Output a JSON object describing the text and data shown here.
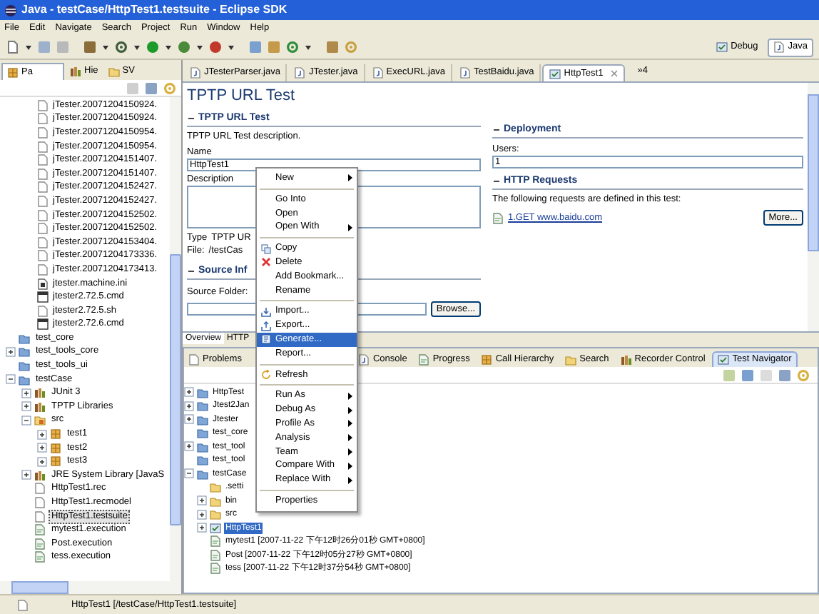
{
  "window": {
    "title": "Java - testCase/HttpTest1.testsuite - Eclipse SDK"
  },
  "menu_bar": [
    "File",
    "Edit",
    "Navigate",
    "Search",
    "Project",
    "Run",
    "Window",
    "Help"
  ],
  "perspectives": [
    {
      "label": "Debug",
      "selected": false
    },
    {
      "label": "Java",
      "selected": true
    }
  ],
  "left_panel": {
    "tabs": [
      {
        "label": "Pa",
        "selected": true
      },
      {
        "label": "Hie",
        "selected": false
      },
      {
        "label": "SV",
        "selected": false
      }
    ],
    "tree_continued": [
      {
        "label": "jTester.20071204150924.",
        "kind": "file",
        "selected": false
      },
      {
        "label": "jTester.20071204150924.",
        "kind": "file",
        "selected": false
      },
      {
        "label": "jTester.20071204150954.",
        "kind": "file",
        "selected": false
      },
      {
        "label": "jTester.20071204150954.",
        "kind": "file",
        "selected": false
      },
      {
        "label": "jTester.20071204151407.",
        "kind": "file",
        "selected": false
      },
      {
        "label": "jTester.20071204151407.",
        "kind": "file",
        "selected": false
      },
      {
        "label": "jTester.20071204152427.",
        "kind": "file",
        "selected": false
      },
      {
        "label": "jTester.20071204152427.",
        "kind": "file",
        "selected": false
      },
      {
        "label": "jTester.20071204152502.",
        "kind": "file",
        "selected": false
      },
      {
        "label": "jTester.20071204152502.",
        "kind": "file",
        "selected": false
      },
      {
        "label": "jTester.20071204153404.",
        "kind": "file",
        "selected": false
      },
      {
        "label": "jTester.20071204173336.",
        "kind": "file",
        "selected": false
      },
      {
        "label": "jTester.20071204173413.",
        "kind": "file",
        "selected": false
      },
      {
        "label": "jtester.machine.ini",
        "kind": "ini",
        "selected": false
      },
      {
        "label": "jtester2.72.5.cmd",
        "kind": "cmd",
        "selected": false
      },
      {
        "label": "jtester2.72.5.sh",
        "kind": "file",
        "selected": false
      },
      {
        "label": "jtester2.72.6.cmd",
        "kind": "cmd",
        "selected": false
      }
    ],
    "tree": [
      {
        "label": "test_core",
        "kind": "project",
        "selected": false
      },
      {
        "label": "test_tools_core",
        "kind": "project",
        "expanded": false,
        "selected": false
      },
      {
        "label": "test_tools_ui",
        "kind": "project",
        "selected": false
      },
      {
        "label": "testCase",
        "kind": "project",
        "expanded": true,
        "selected": false,
        "children": [
          {
            "label": "JUnit 3",
            "kind": "library",
            "expanded": false,
            "selected": false
          },
          {
            "label": "TPTP Libraries",
            "kind": "library",
            "expanded": false,
            "selected": false
          },
          {
            "label": "src",
            "kind": "srcfolder",
            "expanded": true,
            "selected": false,
            "children": [
              {
                "label": "test1",
                "kind": "package",
                "expanded": false,
                "selected": false
              },
              {
                "label": "test2",
                "kind": "package",
                "expanded": false,
                "selected": false
              },
              {
                "label": "test3",
                "kind": "package",
                "expanded": false,
                "selected": false
              }
            ]
          },
          {
            "label": "JRE System Library [JavaS",
            "kind": "library",
            "expanded": false,
            "selected": false
          },
          {
            "label": "HttpTest1.rec",
            "kind": "file",
            "selected": false
          },
          {
            "label": "HttpTest1.recmodel",
            "kind": "file",
            "selected": false
          },
          {
            "label": "HttpTest1.testsuite",
            "kind": "file",
            "selected": true
          },
          {
            "label": "mytest1.execution",
            "kind": "execution",
            "selected": false
          },
          {
            "label": "Post.execution",
            "kind": "execution",
            "selected": false
          },
          {
            "label": "tess.execution",
            "kind": "execution",
            "selected": false
          }
        ]
      }
    ]
  },
  "editor": {
    "tabs": [
      {
        "label": "JTesterParser.java",
        "kind": "java",
        "selected": false
      },
      {
        "label": "JTester.java",
        "kind": "java",
        "selected": false
      },
      {
        "label": "ExecURL.java",
        "kind": "java",
        "selected": false
      },
      {
        "label": "TestBaidu.java",
        "kind": "java",
        "selected": false
      },
      {
        "label": "HttpTest1",
        "kind": "test",
        "selected": true
      }
    ],
    "overflow": "»4",
    "title": "TPTP URL Test",
    "general": {
      "heading": "TPTP URL Test",
      "expanded": true,
      "description": "TPTP URL Test description.",
      "name_label": "Name",
      "name_value": "HttpTest1",
      "description_label": "Description",
      "type_label": "Type",
      "type_value": "TPTP UR",
      "file_label": "File:",
      "file_value": "/testCas"
    },
    "source": {
      "heading": "Source Inf",
      "expanded": true,
      "folder_label": "Source Folder:",
      "browse_button": "Browse..."
    },
    "deployment": {
      "heading": "Deployment",
      "expanded": true,
      "users_label": "Users:",
      "users_value": "1"
    },
    "requests": {
      "heading": "HTTP Requests",
      "expanded": true,
      "text": "The following requests are defined in this test:",
      "items": [
        "1.GET www.baidu.com"
      ],
      "more_button": "More..."
    },
    "page_tabs": [
      {
        "label": "Overview",
        "selected": true
      },
      {
        "label": "HTTP",
        "selected": false
      }
    ]
  },
  "bottom_panel": {
    "tabs": [
      {
        "label": "Problems",
        "selected": false
      },
      {
        "label": "Console",
        "selected": false
      },
      {
        "label": "Progress",
        "selected": false
      },
      {
        "label": "Call Hierarchy",
        "selected": false
      },
      {
        "label": "Search",
        "selected": false
      },
      {
        "label": "Recorder Control",
        "selected": false
      },
      {
        "label": "Test Navigator",
        "selected": true
      }
    ],
    "tree": [
      {
        "label": "HttpTest",
        "kind": "project",
        "expanded": false,
        "selected": false
      },
      {
        "label": "Jtest2Jan",
        "kind": "project",
        "expanded": false,
        "selected": false
      },
      {
        "label": "Jtester",
        "kind": "project",
        "expanded": false,
        "selected": false
      },
      {
        "label": "test_core",
        "kind": "project",
        "selected": false
      },
      {
        "label": "test_tool",
        "kind": "project",
        "expanded": false,
        "selected": false
      },
      {
        "label": "test_tool",
        "kind": "project",
        "selected": false
      },
      {
        "label": "testCase",
        "kind": "project",
        "expanded": true,
        "selected": false,
        "children": [
          {
            "label": ".setti",
            "kind": "folder",
            "selected": false
          },
          {
            "label": "bin",
            "kind": "folder",
            "expanded": false,
            "selected": false
          },
          {
            "label": "src",
            "kind": "folder",
            "expanded": false,
            "selected": false
          },
          {
            "label": "HttpTest1",
            "kind": "test",
            "expanded": false,
            "selected": true
          },
          {
            "label": "mytest1 [2007-11-22 下午12时26分01秒 GMT+0800]",
            "kind": "execution",
            "selected": false
          },
          {
            "label": "Post [2007-11-22 下午12时05分27秒 GMT+0800]",
            "kind": "execution",
            "selected": false
          },
          {
            "label": "tess [2007-11-22 下午12时37分54秒 GMT+0800]",
            "kind": "execution",
            "selected": false
          }
        ]
      }
    ]
  },
  "context_menu": [
    {
      "kind": "item",
      "label": "New",
      "submenu": true,
      "selected": false
    },
    {
      "kind": "separator"
    },
    {
      "kind": "item",
      "label": "Go Into",
      "submenu": false,
      "selected": false
    },
    {
      "kind": "item",
      "label": "Open",
      "submenu": false,
      "selected": false
    },
    {
      "kind": "item",
      "label": "Open With",
      "submenu": true,
      "selected": false
    },
    {
      "kind": "separator"
    },
    {
      "kind": "icon_item",
      "label": "Copy",
      "submenu": false,
      "selected": false
    },
    {
      "kind": "icon_item",
      "label": "Delete",
      "submenu": false,
      "selected": false
    },
    {
      "kind": "item",
      "label": "Add Bookmark...",
      "submenu": false,
      "selected": false
    },
    {
      "kind": "item",
      "label": "Rename",
      "submenu": false,
      "selected": false
    },
    {
      "kind": "separator"
    },
    {
      "kind": "icon_item",
      "label": "Import...",
      "submenu": false,
      "selected": false
    },
    {
      "kind": "icon_item",
      "label": "Export...",
      "submenu": false,
      "selected": false
    },
    {
      "kind": "icon_item",
      "label": "Generate...",
      "submenu": false,
      "selected": true
    },
    {
      "kind": "item",
      "label": "Report...",
      "submenu": false,
      "selected": false
    },
    {
      "kind": "separator"
    },
    {
      "kind": "icon_item",
      "label": "Refresh",
      "submenu": false,
      "selected": false
    },
    {
      "kind": "separator"
    },
    {
      "kind": "item",
      "label": "Run As",
      "submenu": true,
      "selected": false
    },
    {
      "kind": "item",
      "label": "Debug As",
      "submenu": true,
      "selected": false
    },
    {
      "kind": "item",
      "label": "Profile As",
      "submenu": true,
      "selected": false
    },
    {
      "kind": "item",
      "label": "Analysis",
      "submenu": true,
      "selected": false
    },
    {
      "kind": "item",
      "label": "Team",
      "submenu": true,
      "selected": false
    },
    {
      "kind": "item",
      "label": "Compare With",
      "submenu": true,
      "selected": false
    },
    {
      "kind": "item",
      "label": "Replace With",
      "submenu": true,
      "selected": false
    },
    {
      "kind": "separator"
    },
    {
      "kind": "item",
      "label": "Properties",
      "submenu": false,
      "selected": false
    }
  ],
  "status_bar": {
    "text": "HttpTest1 [/testCase/HttpTest1.testsuite]"
  }
}
